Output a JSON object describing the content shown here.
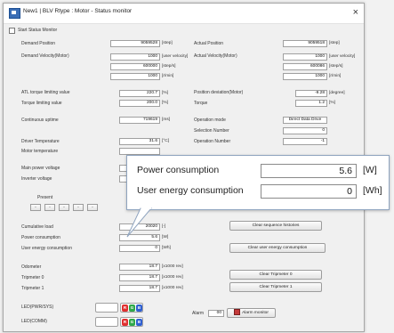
{
  "window": {
    "title": "New1 | BLV Rtype : Motor - Status monitor",
    "close_label": "×"
  },
  "start_monitor": {
    "label": "Start Status Monitor"
  },
  "left": {
    "demand_position": {
      "label": "Demand Position",
      "value": "9059528",
      "unit": "[step]"
    },
    "demand_velocity": {
      "label": "Demand Velocity(Motor)",
      "values": [
        "1000",
        "600000",
        "1000"
      ],
      "units": [
        "[user velocity]",
        "[step/s]",
        "[r/min]"
      ]
    },
    "atl_torque": {
      "label": "ATL torque limiting value",
      "value": "220.7",
      "unit": "[%]"
    },
    "torque_limit": {
      "label": "Torque limiting value",
      "value": "200.0",
      "unit": "[%]"
    },
    "uptime": {
      "label": "Continuous uptime",
      "value": "719619",
      "unit": "[ms]"
    },
    "driver_temp": {
      "label": "Driver Temperature",
      "value": "31.6",
      "unit": "[°C]"
    },
    "motor_temp": {
      "label": "Motor temperature",
      "value": "",
      "unit": ""
    },
    "main_voltage": {
      "label": "Main power voltage",
      "value": "",
      "unit": ""
    },
    "inverter_voltage": {
      "label": "Inverter voltage",
      "value": "",
      "unit": ""
    },
    "present": {
      "label": "Present",
      "buttons": [
        "-",
        "-",
        "-",
        "-",
        "-"
      ]
    },
    "cumulative_load": {
      "label": "Cumulative load",
      "value": "20020",
      "unit": "[-]"
    },
    "power_consumption": {
      "label": "Power consumption",
      "value": "5.6",
      "unit": "[W]"
    },
    "user_energy": {
      "label": "User energy consumption",
      "value": "0",
      "unit": "[Wh]"
    },
    "odometer": {
      "label": "Odometer",
      "value": "18.7",
      "unit": "[x1000 rev]"
    },
    "tripmeter0": {
      "label": "Tripmeter 0",
      "value": "18.7",
      "unit": "[x1000 rev]"
    },
    "tripmeter1": {
      "label": "Tripmeter 1",
      "value": "18.7",
      "unit": "[x1000 rev]"
    },
    "led_pwr": {
      "label": "LED(PWR/SYS)"
    },
    "led_com": {
      "label": "LED(COMM)"
    }
  },
  "right": {
    "actual_position": {
      "label": "Actual Position",
      "value": "9059518",
      "unit": "[step]"
    },
    "actual_velocity": {
      "label": "Actual Velocity(Motor)",
      "values": [
        "1000",
        "600086",
        "1000"
      ],
      "units": [
        "[user velocity]",
        "[step/s]",
        "[r/min]"
      ]
    },
    "position_deviation": {
      "label": "Position deviation(Motor)",
      "value": "-9.28",
      "unit": "[degree]"
    },
    "torque": {
      "label": "Torque",
      "value": "1.2",
      "unit": "[%]"
    },
    "operation_mode": {
      "label": "Operation mode",
      "value": "Direct Data Drive"
    },
    "selection_number": {
      "label": "Selection Number",
      "value": "0"
    },
    "operation_number": {
      "label": "Operation Number",
      "value": "-1"
    },
    "alarm": {
      "label": "Alarm",
      "value": "00"
    }
  },
  "buttons": {
    "clear_sequence": "Clear sequence histories",
    "clear_user_energy": "Clear user energy consumption",
    "clear_trip0": "Clear Tripmeter 0",
    "clear_trip1": "Clear Tripmeter 1",
    "alarm_monitor": "Alarm monitor"
  },
  "leds": {
    "r": "R",
    "g": "G",
    "b": "B",
    "colors": {
      "red": "#e03030",
      "green": "#2fa84a",
      "blue": "#2f5fd0"
    }
  },
  "callout": {
    "power": {
      "label": "Power consumption",
      "value": "5.6",
      "unit": "[W]"
    },
    "energy": {
      "label": "User energy consumption",
      "value": "0",
      "unit": "[Wh]"
    }
  }
}
